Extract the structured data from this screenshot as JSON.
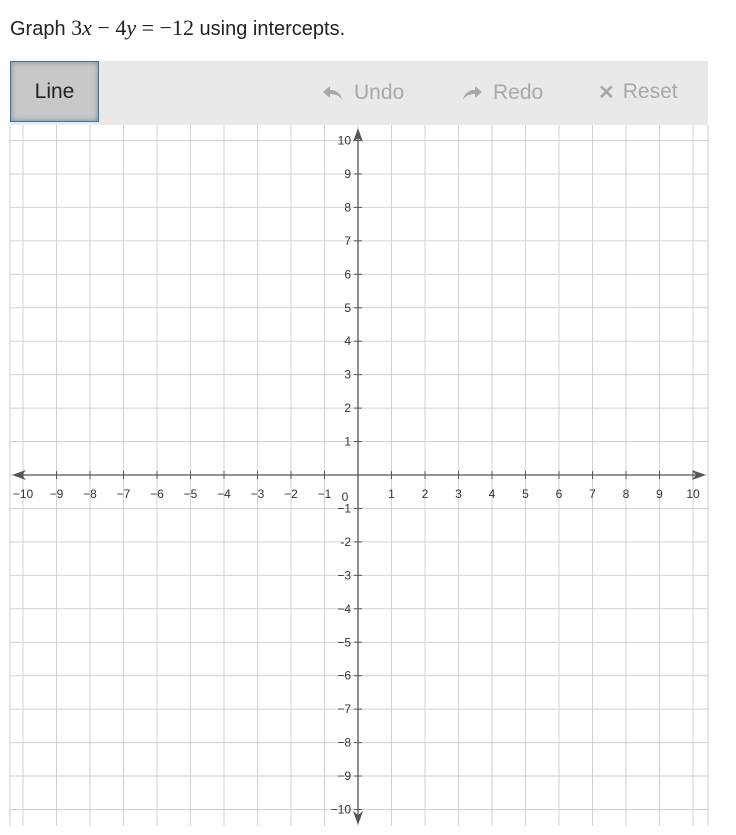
{
  "prompt": {
    "lead": "Graph",
    "equation": {
      "a": "3",
      "x": "x",
      "op": "−",
      "b": "4",
      "y": "y",
      "eq": "=",
      "c": "−12"
    },
    "tail": "using intercepts."
  },
  "toolbar": {
    "line_label": "Line",
    "undo_label": "Undo",
    "redo_label": "Redo",
    "reset_label": "Reset",
    "icons": {
      "undo": "undo-arrow-icon",
      "redo": "redo-arrow-icon",
      "reset": "close-x-icon"
    },
    "disabled_color": "#a8a8a8"
  },
  "chart_data": {
    "type": "scatter",
    "xlim": [
      -10,
      10
    ],
    "ylim": [
      -10,
      10
    ],
    "x_ticks": [
      -10,
      -9,
      -8,
      -7,
      -6,
      -5,
      -4,
      -3,
      -2,
      -1,
      1,
      2,
      3,
      4,
      5,
      6,
      7,
      8,
      9,
      10
    ],
    "y_ticks": [
      10,
      9,
      8,
      7,
      6,
      5,
      4,
      3,
      2,
      1,
      -1,
      -2,
      -3,
      -4,
      -5,
      -6,
      -7,
      -8,
      -9,
      -10
    ],
    "x_tick_labels": [
      "−10",
      "−9",
      "−8",
      "−7",
      "−6",
      "−5",
      "−4",
      "−3",
      "−2",
      "−1",
      "1",
      "2",
      "3",
      "4",
      "5",
      "6",
      "7",
      "8",
      "9",
      "10"
    ],
    "y_tick_labels": [
      "10",
      "9",
      "8",
      "7",
      "6",
      "5",
      "4",
      "3",
      "2",
      "1",
      "−1",
      "-2",
      "−3",
      "−4",
      "−5",
      "−6",
      "−7",
      "−8",
      "−9",
      "−10"
    ],
    "origin_label": "0",
    "grid": true,
    "series": []
  }
}
